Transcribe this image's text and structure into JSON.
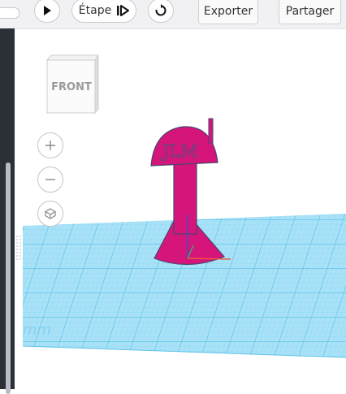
{
  "toolbar": {
    "play_icon": "play-icon",
    "step_label": "Étape",
    "step_icon": "step-forward-icon",
    "reset_icon": "reset-icon",
    "export_label": "Exporter",
    "share_label": "Partager"
  },
  "viewport": {
    "viewcube_label": "FRONT",
    "zoom_in_icon": "plus-icon",
    "zoom_out_icon": "minus-icon",
    "home_icon": "home-view-icon",
    "model_text": "JLM",
    "model_color": "#d6157a",
    "grid_color": "#56c9ee",
    "workplane_fill": "#a9e1f7"
  }
}
